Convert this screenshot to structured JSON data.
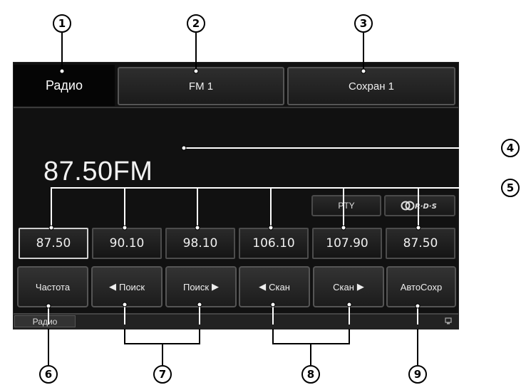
{
  "tabs": {
    "source": "Радио",
    "band": "FM 1",
    "memory": "Сохран 1"
  },
  "frequency": "87.50FM",
  "indicators": {
    "pty": "PTY",
    "rds_icon": "rds-logo-icon"
  },
  "presets": [
    "87.50",
    "90.10",
    "98.10",
    "106.10",
    "107.90",
    "87.50"
  ],
  "controls": {
    "frequency": "Частота",
    "seek_down": "Поиск",
    "seek_up": "Поиск",
    "scan_down": "Скан",
    "scan_up": "Скан",
    "auto_store": "АвтоСохр"
  },
  "status_bar": {
    "source_label": "Радио"
  },
  "callouts": [
    "1",
    "2",
    "3",
    "4",
    "5",
    "6",
    "7",
    "8",
    "9"
  ]
}
